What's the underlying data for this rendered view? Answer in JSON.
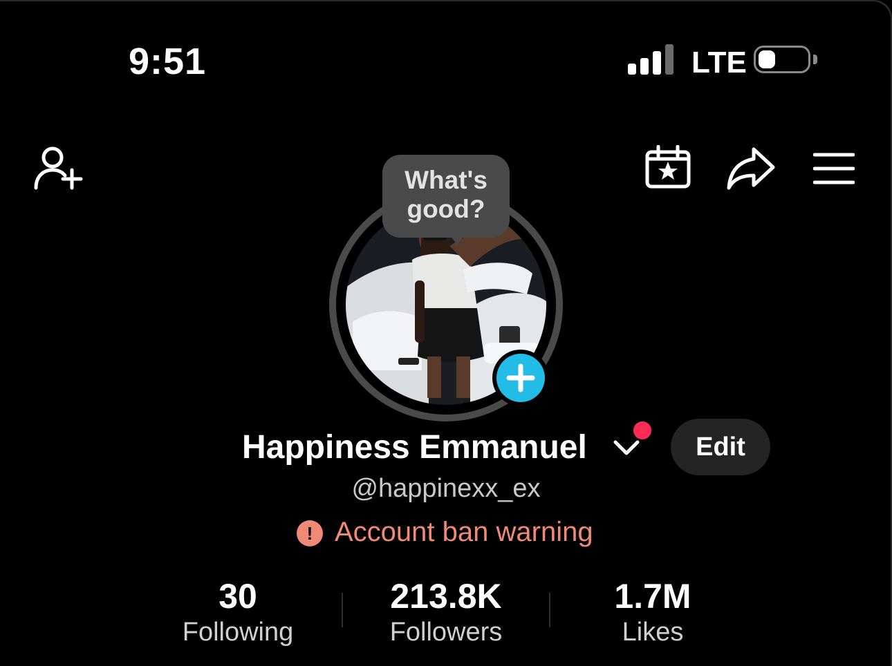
{
  "status_bar": {
    "time": "9:51",
    "network": "LTE",
    "signal_bars_active": 3,
    "signal_bars_total": 4,
    "battery_level": 0.35
  },
  "toolbar": {
    "icons": [
      "add-friend-icon",
      "calendar-star-icon",
      "share-icon",
      "menu-icon"
    ]
  },
  "profile": {
    "status_bubble": [
      "What's",
      "good?"
    ],
    "display_name": "Happiness Emmanuel",
    "edit_label": "Edit",
    "username": "@happinexx_ex",
    "warning_text": "Account ban warning",
    "warning_icon_glyph": "!"
  },
  "stats": [
    {
      "value": "30",
      "label": "Following"
    },
    {
      "value": "213.8K",
      "label": "Followers"
    },
    {
      "value": "1.7M",
      "label": "Likes"
    }
  ],
  "colors": {
    "background": "#000000",
    "accent_blue": "#22bce6",
    "notification_red": "#fe2c55",
    "warning_salmon": "#f08a76",
    "bubble_gray": "#4a4a4a",
    "edit_button_bg": "#242424"
  }
}
